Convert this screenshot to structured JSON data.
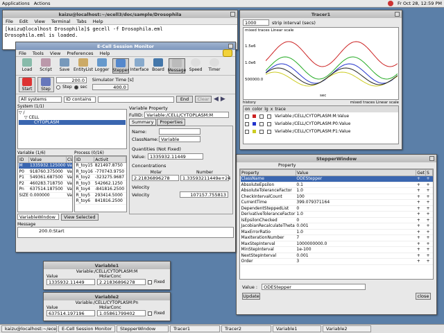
{
  "topbar": {
    "apps": "Applications",
    "actions": "Actions",
    "clock": "Fr Oct 28, 12:59 PM"
  },
  "terminal": {
    "title": "kaizu@localhost:~/ecell3/doc/sample/Drosophila",
    "menu": [
      "File",
      "Edit",
      "View",
      "Terminal",
      "Tabs",
      "Help"
    ],
    "lines": [
      "[kaizu@localhost Drosophila]$ gecell -f Drosophila.eml",
      "Drosophila.eml is loaded."
    ]
  },
  "session": {
    "title": "E-Cell Session Monitor",
    "menu": [
      "File",
      "Tools",
      "View",
      "Preferences",
      "Help"
    ],
    "tools": [
      "Load",
      "Script",
      "Save",
      "EntityList",
      "Logger",
      "Stepper",
      "Interface",
      "Board",
      "Message",
      "Speed",
      "Timer"
    ],
    "start": "Start",
    "step": "Step",
    "step_value": "200.0",
    "sim_time_label": "Simulator Time [s]",
    "sim_time": "400.0",
    "step_unit": "Step",
    "sec_unit": "sec",
    "systems_select": "All systems",
    "id_select": "ID contains",
    "end_btn": "End",
    "clear_btn": "Clear",
    "system_label": "System (1/1)",
    "tree": [
      "/",
      "CELL",
      "CYTOPLASM"
    ],
    "var_label": "Variable (1/6)",
    "var_cols": [
      "ID",
      "Value",
      "Cla"
    ],
    "vars": [
      [
        "M",
        "1335932.125000",
        "Var"
      ],
      [
        "P0",
        "918760.375000",
        "Var"
      ],
      [
        "P1",
        "549361.687500",
        "Var"
      ],
      [
        "P2",
        "460283.718750",
        "Var"
      ],
      [
        "Pn",
        "637514.187500",
        "Var"
      ],
      [
        "SIZE",
        "0.000000",
        "Var"
      ]
    ],
    "proc_label": "Process (0/16)",
    "proc_cols": [
      "ID",
      "Activit"
    ],
    "procs": [
      [
        "R_toy15",
        "821497.8750"
      ],
      [
        "R_toy16",
        "-770743.9750"
      ],
      [
        "R_toy2",
        "-323275.9687"
      ],
      [
        "R_toy3",
        "542662.1250"
      ],
      [
        "R_toy4",
        "-841816.2500"
      ],
      [
        "R_toy5",
        "293414.5000"
      ],
      [
        "R_toy6",
        "841816.2500"
      ]
    ],
    "varwin_select": "VariableWindow",
    "view_selected": "View Selected",
    "message_label": "Message",
    "message": "200.0:Start",
    "vp_title": "Variable Property",
    "fullid_label": "FullID:",
    "fullid": "Variable:/CELL/CYTOPLASM:M",
    "tab_summary": "Summary",
    "tab_props": "Properties",
    "name_label": "Name:",
    "name": "",
    "classname_label": "ClassName:",
    "classname": "Variable",
    "qty_label": "Quantities (Not Fixed)",
    "value_label": "Value:",
    "value": "1335932.11449",
    "conc_label": "Concentrations",
    "molar": "Molar",
    "number": "Number",
    "molar_val": "2.21836896278",
    "number_val": "1.33593211449e+24",
    "vel_label": "Velocity",
    "velocity_label": "Velocity",
    "velocity": "107157.755813"
  },
  "tracer": {
    "title": "Tracer1",
    "strip": "1000",
    "strip_label": "strip interval (secs)",
    "mode": "mixed traces  Linear scale",
    "yticks": [
      "1.5e6",
      "1.0e6",
      "500000.0"
    ],
    "xlabel": "sec",
    "bottom_mode": "mixed traces  Linear scale",
    "history": "history",
    "cols": [
      "on",
      "color",
      "lg",
      "x",
      "trace"
    ],
    "traces": [
      "Variable:/CELL/CYTOPLASM:M:Value",
      "Variable:/CELL/CYTOPLASM:P0:Value",
      "Variable:/CELL/CYTOPLASM:P1:Value"
    ],
    "colors": [
      "#cc2222",
      "#2233cc",
      "#cccc22"
    ]
  },
  "stepper": {
    "title": "StepperWindow",
    "prop_header": "Property",
    "cols": [
      "Property",
      "Value",
      "Get",
      "S"
    ],
    "rows": [
      [
        "ClassName",
        "ODEStepper"
      ],
      [
        "AbsoluteEpsilon",
        "0.1"
      ],
      [
        "AbsoluteToleranceFactor",
        "1.0"
      ],
      [
        "CheckIntervalCount",
        "100"
      ],
      [
        "CurrentTime",
        "399.079371164"
      ],
      [
        "DependentSteppedList",
        "0"
      ],
      [
        "DerivativeToleranceFactor",
        "1.0"
      ],
      [
        "IsEpsilonChecked",
        "0"
      ],
      [
        "JacobianRecalculateTheta",
        "0.001"
      ],
      [
        "MaxErrorRatio",
        "1.0"
      ],
      [
        "MaxIterationNumber",
        "7"
      ],
      [
        "MaxStepInterval",
        "1000000000.0"
      ],
      [
        "MinStepInterval",
        "1e-100"
      ],
      [
        "NextStepInterval",
        "0.001"
      ],
      [
        "Order",
        "3"
      ]
    ],
    "value_label": "Value :",
    "value": "ODEStepper",
    "update": "Update",
    "close": "close"
  },
  "var1": {
    "title": "Variable1",
    "header": "Variable:/CELL/CYTOPLASM:M",
    "value_label": "Value",
    "molar_label": "MolarConc",
    "value": "1335932.11449",
    "molar": "2.21836896278",
    "fixed": "Fixed"
  },
  "var2": {
    "title": "Variable2",
    "header": "Variable:/CELL/CYTOPLASM:Pn",
    "value_label": "Value",
    "molar_label": "MolarConc",
    "value": "637514.197196",
    "molar": "1.05861799402",
    "fixed": "Fixed"
  },
  "taskbar": [
    "kaizu@localhost:~/ecell3",
    "E-Cell Session Monitor",
    "StepperWindow",
    "Tracer1",
    "Tracer2",
    "Variable1",
    "Variable2"
  ]
}
